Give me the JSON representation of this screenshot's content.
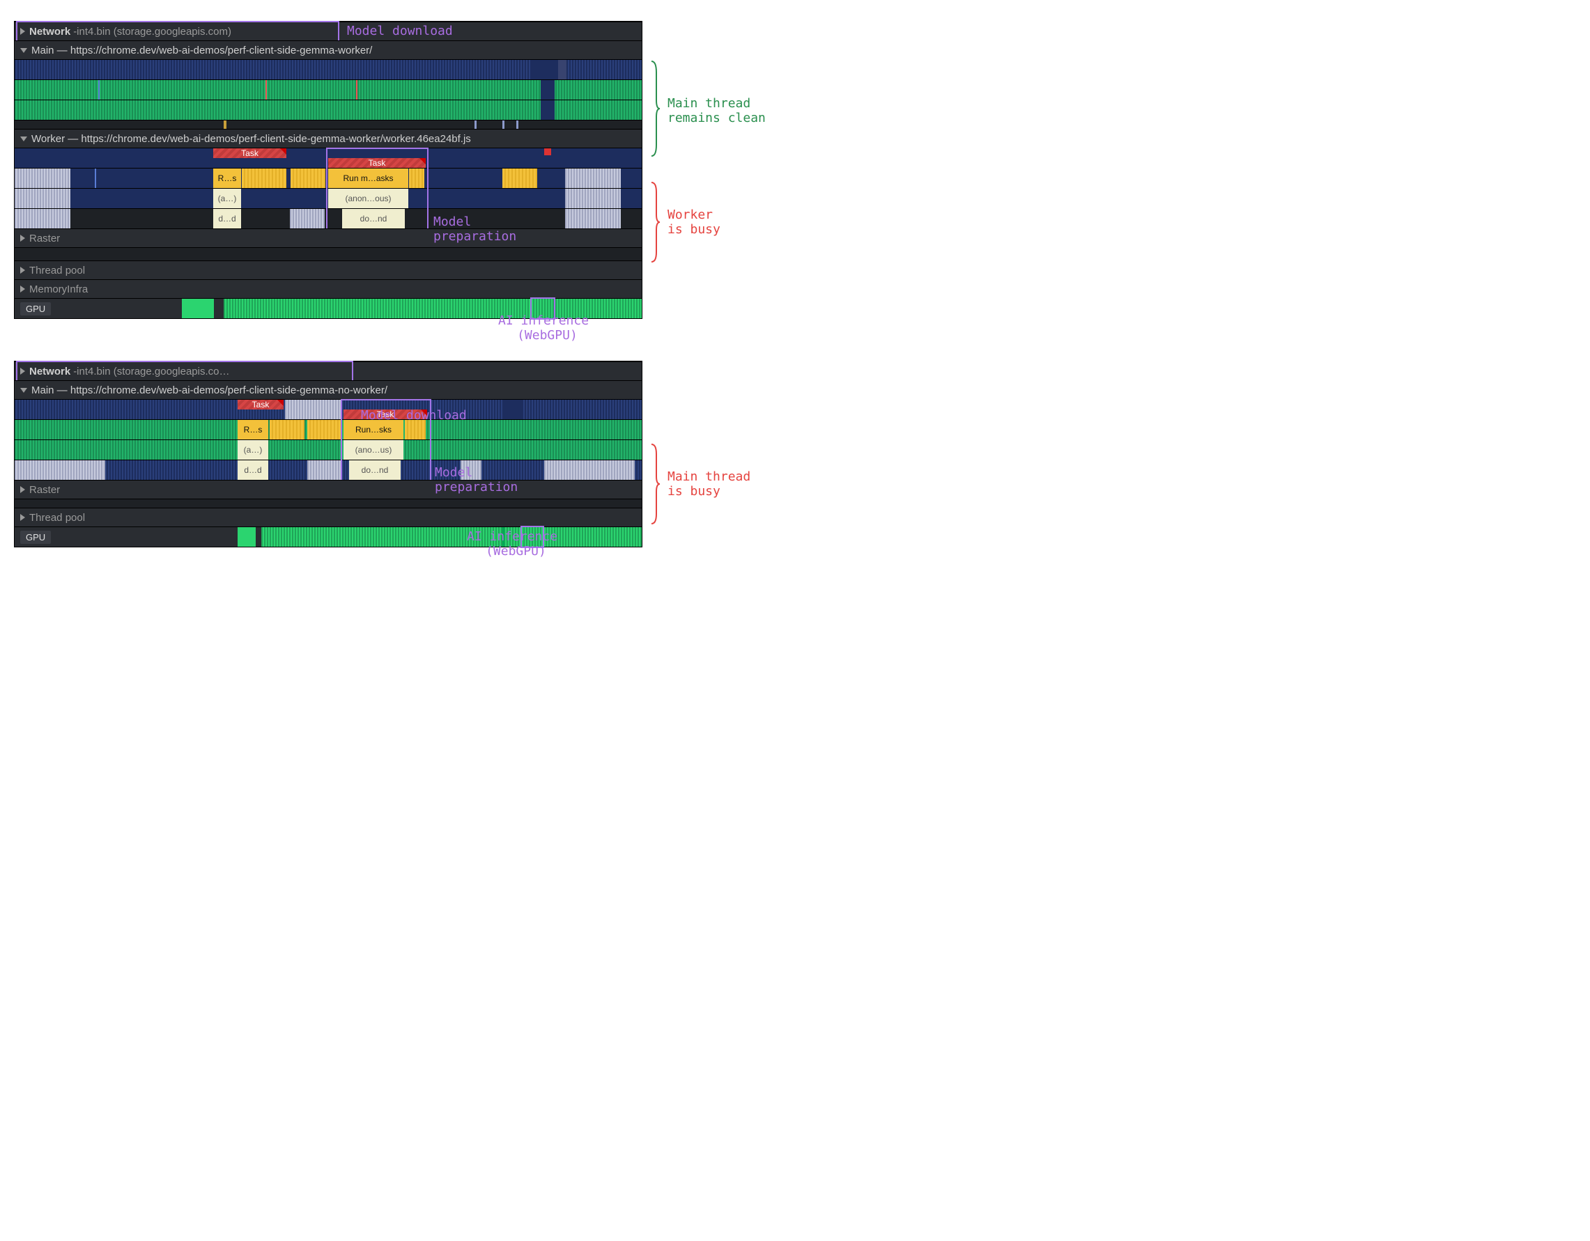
{
  "panelA": {
    "network": {
      "label": "Network",
      "tail": "-int4.bin (storage.googleapis.com)"
    },
    "main": {
      "label": "Main —",
      "url": "https://chrome.dev/web-ai-demos/perf-client-side-gemma-worker/"
    },
    "worker": {
      "label": "Worker —",
      "url": "https://chrome.dev/web-ai-demos/perf-client-side-gemma-worker/worker.46ea24bf.js"
    },
    "raster": "Raster",
    "threadpool": "Thread pool",
    "memoryinfra": "MemoryInfra",
    "gpu": "GPU",
    "tasks": {
      "task": "Task",
      "rs": "R…s",
      "runm": "Run m…asks",
      "anon1": "(a…)",
      "anon2": "(anon…ous)",
      "dd": "d…d",
      "dond": "do…nd"
    },
    "ann": {
      "model_dl": "Model download",
      "main_clean": "Main thread\nremains clean",
      "worker_busy": "Worker\nis busy",
      "model_prep": "Model\npreparation",
      "ai_inf": "AI inference\n (WebGPU)"
    }
  },
  "panelB": {
    "network": {
      "label": "Network",
      "tail": "-int4.bin (storage.googleapis.co…"
    },
    "main": {
      "label": "Main —",
      "url": "https://chrome.dev/web-ai-demos/perf-client-side-gemma-no-worker/"
    },
    "raster": "Raster",
    "threadpool": "Thread pool",
    "gpu": "GPU",
    "tasks": {
      "task": "Task",
      "rs": "R…s",
      "runsks": "Run…sks",
      "anon1": "(a…)",
      "anon2": "(ano…us)",
      "dd": "d…d",
      "dond": "do…nd"
    },
    "ann": {
      "model_dl": "Model download",
      "main_busy": "Main thread\nis busy",
      "model_prep": "Model\npreparation",
      "ai_inf": "AI inference\n (WebGPU)"
    }
  }
}
